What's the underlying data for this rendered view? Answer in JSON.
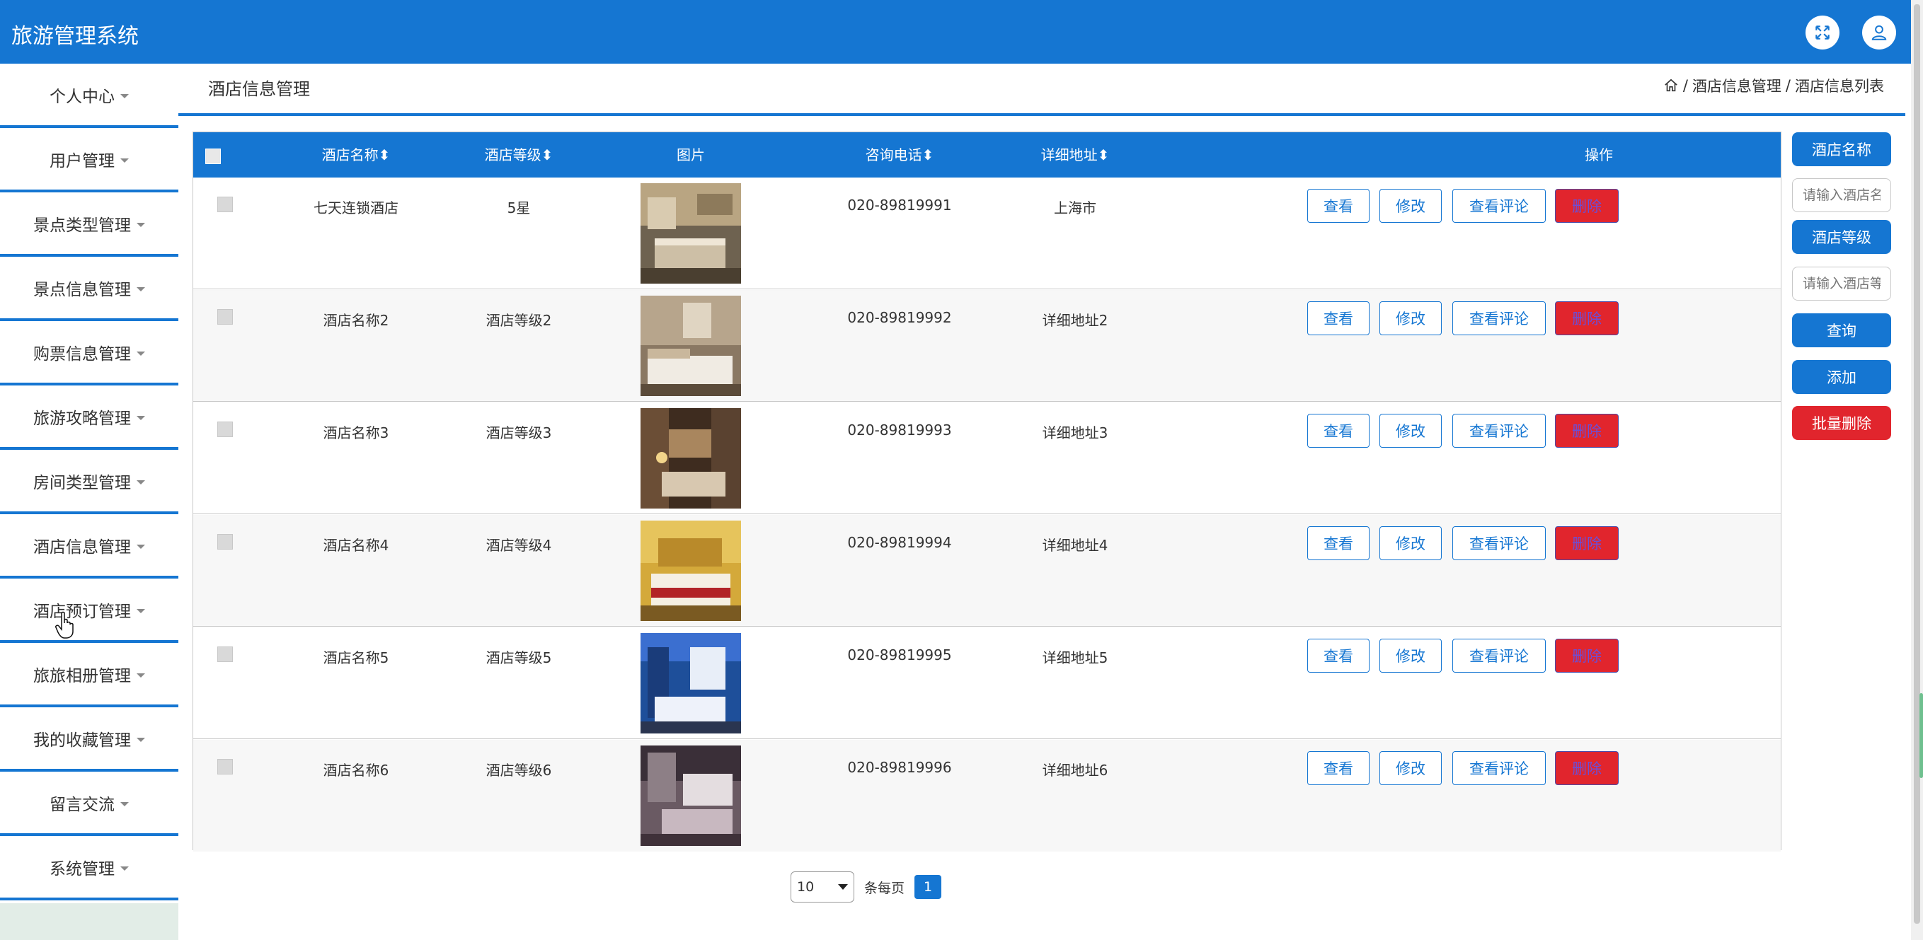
{
  "app": {
    "title": "旅游管理系统"
  },
  "header": {
    "fullscreen_icon": "fullscreen-icon",
    "user_icon": "user-icon"
  },
  "sidebar": {
    "items": [
      {
        "label": "个人中心"
      },
      {
        "label": "用户管理"
      },
      {
        "label": "景点类型管理"
      },
      {
        "label": "景点信息管理"
      },
      {
        "label": "购票信息管理"
      },
      {
        "label": "旅游攻略管理"
      },
      {
        "label": "房间类型管理"
      },
      {
        "label": "酒店信息管理"
      },
      {
        "label": "酒店预订管理"
      },
      {
        "label": "旅旅相册管理"
      },
      {
        "label": "我的收藏管理"
      },
      {
        "label": "留言交流"
      },
      {
        "label": "系统管理"
      }
    ]
  },
  "page": {
    "title": "酒店信息管理",
    "breadcrumb": {
      "home_icon": "home-icon",
      "sep": "/",
      "level1": "酒店信息管理",
      "level2": "酒店信息列表"
    }
  },
  "table": {
    "headers": {
      "name": "酒店名称",
      "level": "酒店等级",
      "image": "图片",
      "phone": "咨询电话",
      "address": "详细地址",
      "actions": "操作"
    },
    "sort_glyph": "⬍",
    "actions": {
      "view": "查看",
      "edit": "修改",
      "review": "查看评论",
      "delete": "删除"
    },
    "rows": [
      {
        "name": "七天连锁酒店",
        "level": "5星",
        "phone": "020-89819991",
        "address": "上海市"
      },
      {
        "name": "酒店名称2",
        "level": "酒店等级2",
        "phone": "020-89819992",
        "address": "详细地址2"
      },
      {
        "name": "酒店名称3",
        "level": "酒店等级3",
        "phone": "020-89819993",
        "address": "详细地址3"
      },
      {
        "name": "酒店名称4",
        "level": "酒店等级4",
        "phone": "020-89819994",
        "address": "详细地址4"
      },
      {
        "name": "酒店名称5",
        "level": "酒店等级5",
        "phone": "020-89819995",
        "address": "详细地址5"
      },
      {
        "name": "酒店名称6",
        "level": "酒店等级6",
        "phone": "020-89819996",
        "address": "详细地址6"
      }
    ]
  },
  "search": {
    "name_label": "酒店名称",
    "name_placeholder": "请输入酒店名称",
    "level_label": "酒店等级",
    "level_placeholder": "请输入酒店等级",
    "query": "查询",
    "add": "添加",
    "batch_delete": "批量删除"
  },
  "pagination": {
    "page_size": "10",
    "per_page_label": "条每页",
    "current_page": "1"
  },
  "colors": {
    "primary": "#1576d2",
    "danger": "#e1252d",
    "border": "#c8c8c8"
  }
}
